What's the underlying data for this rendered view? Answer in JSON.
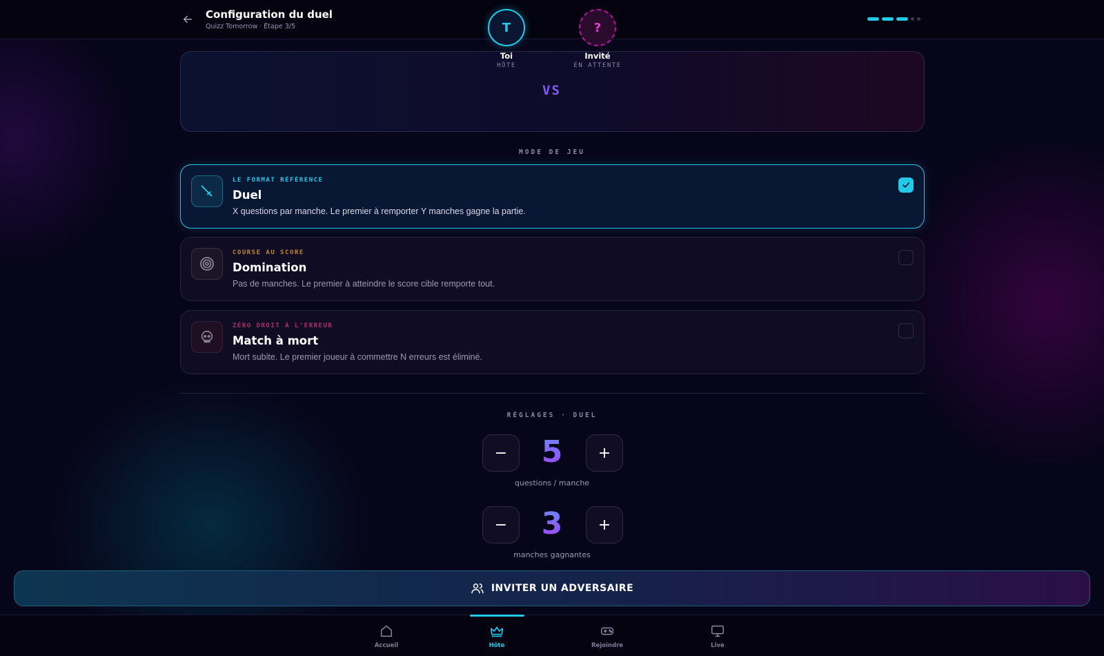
{
  "header": {
    "title": "Configuration du duel",
    "subtitle": "Quizz Tomorrow · Étape 3/5",
    "steps_total": 5,
    "steps_done": 3
  },
  "versus": {
    "host": {
      "initial": "T",
      "name": "Toi",
      "role": "HÔTE"
    },
    "vs_label": "VS",
    "guest": {
      "initial": "?",
      "name": "Invité",
      "role": "EN ATTENTE"
    }
  },
  "mode_section": {
    "label": "MODE DE JEU"
  },
  "modes": [
    {
      "tag": "LE FORMAT RÉFÉRENCE",
      "name": "Duel",
      "description": "X questions par manche. Le premier à remporter Y manches gagne la partie.",
      "icon": "sword-icon",
      "selected": true
    },
    {
      "tag": "COURSE AU SCORE",
      "name": "Domination",
      "description": "Pas de manches. Le premier à atteindre le score cible remporte tout.",
      "icon": "target-icon",
      "selected": false
    },
    {
      "tag": "ZÉRO DROIT À L'ERREUR",
      "name": "Match à mort",
      "description": "Mort subite. Le premier joueur à commettre N erreurs est éliminé.",
      "icon": "skull-icon",
      "selected": false
    }
  ],
  "settings": {
    "label": "RÉGLAGES · DUEL",
    "questions": {
      "value": "5",
      "label": "questions / manche",
      "minus": "−",
      "plus": "+"
    },
    "rounds": {
      "value": "3",
      "label": "manches gagnantes",
      "minus": "−",
      "plus": "+"
    }
  },
  "invite": {
    "label": "INVITER UN ADVERSAIRE"
  },
  "nav": {
    "items": [
      {
        "label": "Accueil",
        "icon": "home-icon",
        "active": false
      },
      {
        "label": "Hôte",
        "icon": "crown-icon",
        "active": true
      },
      {
        "label": "Rejoindre",
        "icon": "gamepad-icon",
        "active": false
      },
      {
        "label": "Live",
        "icon": "monitor-icon",
        "active": false
      }
    ]
  },
  "colors": {
    "accent": "#22c9e8",
    "background": "#07051a",
    "guest": "#b0189d",
    "domination_tag": "#c08a2a",
    "deathmatch_tag": "#b0306a"
  }
}
